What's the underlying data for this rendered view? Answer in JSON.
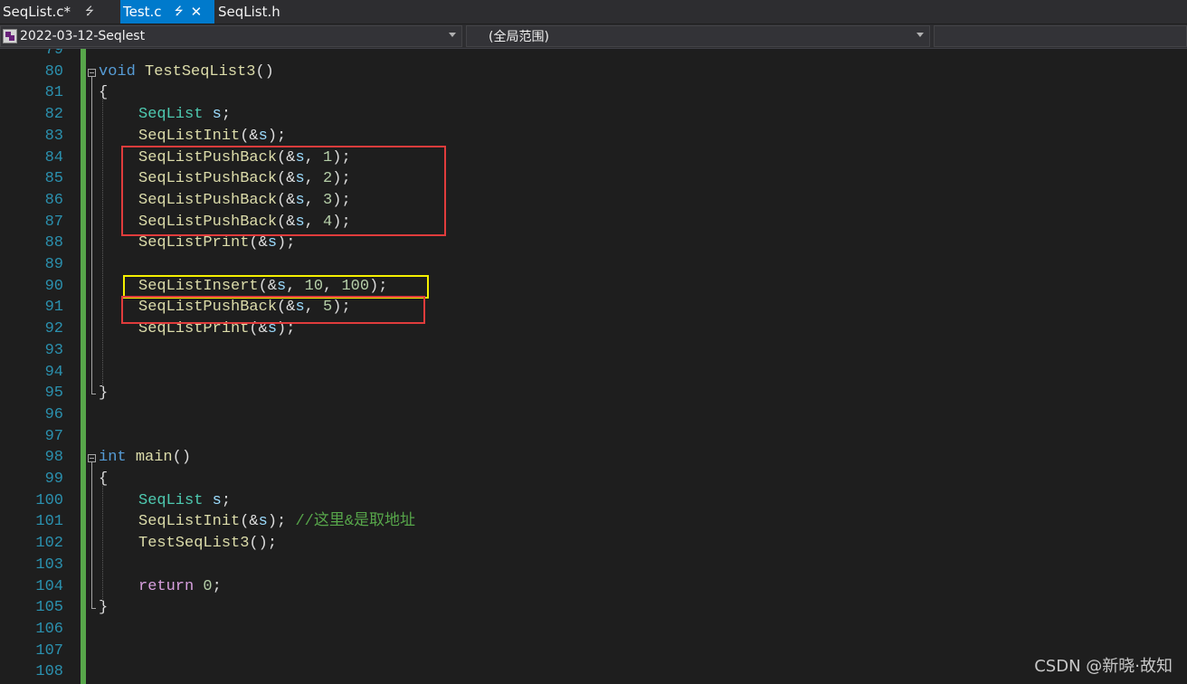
{
  "tabs": [
    {
      "label": "SeqList.c*",
      "pin_glyph": "⭍"
    },
    {
      "label": "Test.c",
      "pin_glyph": "⭍",
      "close_glyph": "✕"
    },
    {
      "label": "SeqList.h"
    }
  ],
  "navbar": {
    "project": "2022-03-12-Seqlest",
    "scope": "(全局范围)"
  },
  "colors": {
    "keyword": "#569cd6",
    "control_keyword": "#d8a0df",
    "type": "#4ec9b0",
    "function": "#dcdcaa",
    "variable": "#9cdcfe",
    "number": "#b5cea8",
    "comment": "#57a64a",
    "line_number": "#2b91af",
    "active_tab": "#007acc",
    "highlight_red": "#e03c3c",
    "highlight_yellow": "#f5f000"
  },
  "lines": [
    {
      "n": "79",
      "tokens": []
    },
    {
      "n": "80",
      "fold": "start",
      "tokens": [
        [
          "kw",
          "void"
        ],
        [
          "t",
          " "
        ],
        [
          "fn",
          "TestSeqList3"
        ],
        [
          "t",
          "()"
        ]
      ]
    },
    {
      "n": "81",
      "tokens": [
        [
          "t",
          "{"
        ]
      ]
    },
    {
      "n": "82",
      "indent": true,
      "tokens": [
        [
          "ty",
          "SeqList"
        ],
        [
          "t",
          " "
        ],
        [
          "var",
          "s"
        ],
        [
          "t",
          ";"
        ]
      ]
    },
    {
      "n": "83",
      "indent": true,
      "tokens": [
        [
          "fn",
          "SeqListInit"
        ],
        [
          "t",
          "(&"
        ],
        [
          "var",
          "s"
        ],
        [
          "t",
          ");"
        ]
      ]
    },
    {
      "n": "84",
      "indent": true,
      "tokens": [
        [
          "fn",
          "SeqListPushBack"
        ],
        [
          "t",
          "(&"
        ],
        [
          "var",
          "s"
        ],
        [
          "t",
          ", "
        ],
        [
          "num",
          "1"
        ],
        [
          "t",
          ");"
        ]
      ]
    },
    {
      "n": "85",
      "indent": true,
      "tokens": [
        [
          "fn",
          "SeqListPushBack"
        ],
        [
          "t",
          "(&"
        ],
        [
          "var",
          "s"
        ],
        [
          "t",
          ", "
        ],
        [
          "num",
          "2"
        ],
        [
          "t",
          ");"
        ]
      ]
    },
    {
      "n": "86",
      "indent": true,
      "tokens": [
        [
          "fn",
          "SeqListPushBack"
        ],
        [
          "t",
          "(&"
        ],
        [
          "var",
          "s"
        ],
        [
          "t",
          ", "
        ],
        [
          "num",
          "3"
        ],
        [
          "t",
          ");"
        ]
      ]
    },
    {
      "n": "87",
      "indent": true,
      "tokens": [
        [
          "fn",
          "SeqListPushBack"
        ],
        [
          "t",
          "(&"
        ],
        [
          "var",
          "s"
        ],
        [
          "t",
          ", "
        ],
        [
          "num",
          "4"
        ],
        [
          "t",
          ");"
        ]
      ]
    },
    {
      "n": "88",
      "indent": true,
      "tokens": [
        [
          "fn",
          "SeqListPrint"
        ],
        [
          "t",
          "(&"
        ],
        [
          "var",
          "s"
        ],
        [
          "t",
          ");"
        ]
      ]
    },
    {
      "n": "89",
      "tokens": []
    },
    {
      "n": "90",
      "indent": true,
      "tokens": [
        [
          "fn",
          "SeqListInsert"
        ],
        [
          "t",
          "(&"
        ],
        [
          "var",
          "s"
        ],
        [
          "t",
          ", "
        ],
        [
          "num",
          "10"
        ],
        [
          "t",
          ", "
        ],
        [
          "num",
          "100"
        ],
        [
          "t",
          ");"
        ]
      ]
    },
    {
      "n": "91",
      "indent": true,
      "tokens": [
        [
          "fn",
          "SeqListPushBack"
        ],
        [
          "t",
          "(&"
        ],
        [
          "var",
          "s"
        ],
        [
          "t",
          ", "
        ],
        [
          "num",
          "5"
        ],
        [
          "t",
          ");"
        ]
      ]
    },
    {
      "n": "92",
      "indent": true,
      "tokens": [
        [
          "fn",
          "SeqListPrint"
        ],
        [
          "t",
          "(&"
        ],
        [
          "var",
          "s"
        ],
        [
          "t",
          ");"
        ]
      ]
    },
    {
      "n": "93",
      "tokens": []
    },
    {
      "n": "94",
      "tokens": []
    },
    {
      "n": "95",
      "fold": "end",
      "tokens": [
        [
          "t",
          "}"
        ]
      ]
    },
    {
      "n": "96",
      "tokens": []
    },
    {
      "n": "97",
      "tokens": []
    },
    {
      "n": "98",
      "fold": "start",
      "tokens": [
        [
          "kw",
          "int"
        ],
        [
          "t",
          " "
        ],
        [
          "fn",
          "main"
        ],
        [
          "t",
          "()"
        ]
      ]
    },
    {
      "n": "99",
      "tokens": [
        [
          "t",
          "{"
        ]
      ]
    },
    {
      "n": "100",
      "indent": true,
      "tokens": [
        [
          "ty",
          "SeqList"
        ],
        [
          "t",
          " "
        ],
        [
          "var",
          "s"
        ],
        [
          "t",
          ";"
        ]
      ]
    },
    {
      "n": "101",
      "indent": true,
      "tokens": [
        [
          "fn",
          "SeqListInit"
        ],
        [
          "t",
          "(&"
        ],
        [
          "var",
          "s"
        ],
        [
          "t",
          "); "
        ],
        [
          "cm",
          "//这里&是取地址"
        ]
      ]
    },
    {
      "n": "102",
      "indent": true,
      "tokens": [
        [
          "fn",
          "TestSeqList3"
        ],
        [
          "t",
          "();"
        ]
      ]
    },
    {
      "n": "103",
      "tokens": []
    },
    {
      "n": "104",
      "indent": true,
      "tokens": [
        [
          "kw2",
          "return"
        ],
        [
          "t",
          " "
        ],
        [
          "num",
          "0"
        ],
        [
          "t",
          ";"
        ]
      ]
    },
    {
      "n": "105",
      "fold": "end",
      "tokens": [
        [
          "t",
          "}"
        ]
      ]
    },
    {
      "n": "106",
      "tokens": []
    },
    {
      "n": "107",
      "tokens": []
    },
    {
      "n": "108",
      "tokens": []
    }
  ],
  "watermark": "CSDN @新晓·故知"
}
